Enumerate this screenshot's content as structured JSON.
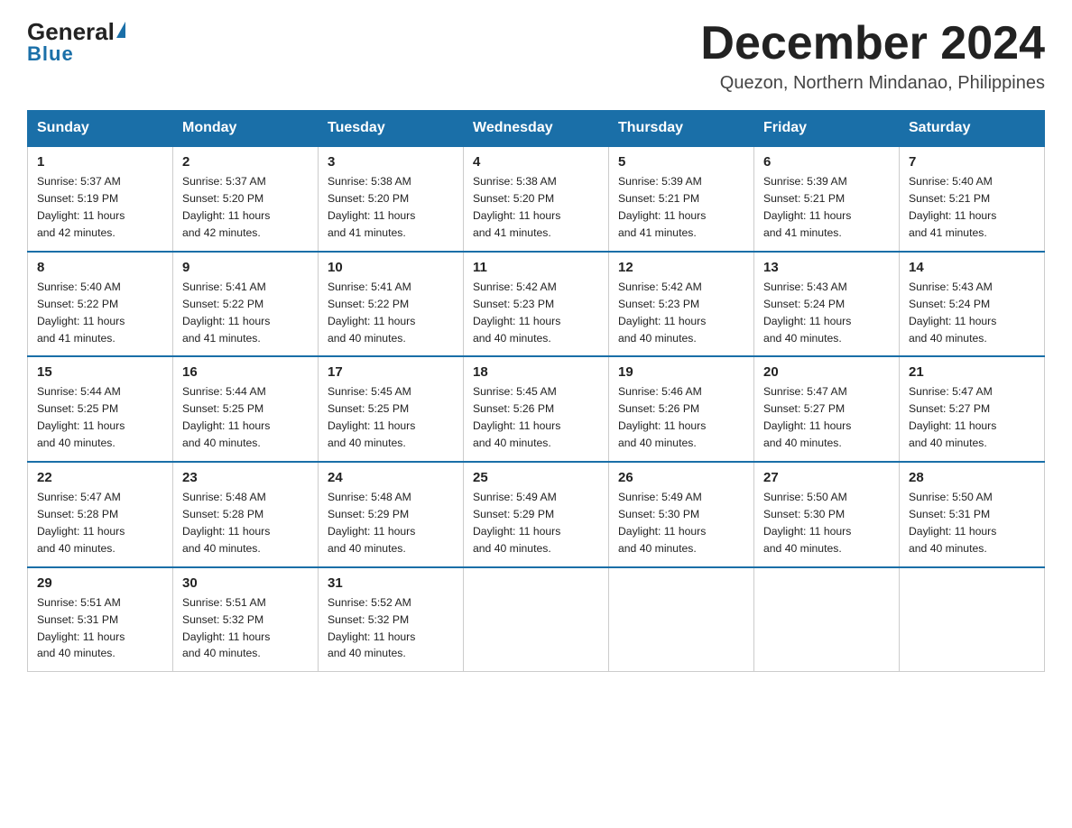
{
  "logo": {
    "general": "General",
    "triangle": "▲",
    "blue": "Blue"
  },
  "title": "December 2024",
  "subtitle": "Quezon, Northern Mindanao, Philippines",
  "days": [
    "Sunday",
    "Monday",
    "Tuesday",
    "Wednesday",
    "Thursday",
    "Friday",
    "Saturday"
  ],
  "weeks": [
    [
      {
        "day": "1",
        "sunrise": "5:37 AM",
        "sunset": "5:19 PM",
        "daylight": "11 hours and 42 minutes."
      },
      {
        "day": "2",
        "sunrise": "5:37 AM",
        "sunset": "5:20 PM",
        "daylight": "11 hours and 42 minutes."
      },
      {
        "day": "3",
        "sunrise": "5:38 AM",
        "sunset": "5:20 PM",
        "daylight": "11 hours and 41 minutes."
      },
      {
        "day": "4",
        "sunrise": "5:38 AM",
        "sunset": "5:20 PM",
        "daylight": "11 hours and 41 minutes."
      },
      {
        "day": "5",
        "sunrise": "5:39 AM",
        "sunset": "5:21 PM",
        "daylight": "11 hours and 41 minutes."
      },
      {
        "day": "6",
        "sunrise": "5:39 AM",
        "sunset": "5:21 PM",
        "daylight": "11 hours and 41 minutes."
      },
      {
        "day": "7",
        "sunrise": "5:40 AM",
        "sunset": "5:21 PM",
        "daylight": "11 hours and 41 minutes."
      }
    ],
    [
      {
        "day": "8",
        "sunrise": "5:40 AM",
        "sunset": "5:22 PM",
        "daylight": "11 hours and 41 minutes."
      },
      {
        "day": "9",
        "sunrise": "5:41 AM",
        "sunset": "5:22 PM",
        "daylight": "11 hours and 41 minutes."
      },
      {
        "day": "10",
        "sunrise": "5:41 AM",
        "sunset": "5:22 PM",
        "daylight": "11 hours and 40 minutes."
      },
      {
        "day": "11",
        "sunrise": "5:42 AM",
        "sunset": "5:23 PM",
        "daylight": "11 hours and 40 minutes."
      },
      {
        "day": "12",
        "sunrise": "5:42 AM",
        "sunset": "5:23 PM",
        "daylight": "11 hours and 40 minutes."
      },
      {
        "day": "13",
        "sunrise": "5:43 AM",
        "sunset": "5:24 PM",
        "daylight": "11 hours and 40 minutes."
      },
      {
        "day": "14",
        "sunrise": "5:43 AM",
        "sunset": "5:24 PM",
        "daylight": "11 hours and 40 minutes."
      }
    ],
    [
      {
        "day": "15",
        "sunrise": "5:44 AM",
        "sunset": "5:25 PM",
        "daylight": "11 hours and 40 minutes."
      },
      {
        "day": "16",
        "sunrise": "5:44 AM",
        "sunset": "5:25 PM",
        "daylight": "11 hours and 40 minutes."
      },
      {
        "day": "17",
        "sunrise": "5:45 AM",
        "sunset": "5:25 PM",
        "daylight": "11 hours and 40 minutes."
      },
      {
        "day": "18",
        "sunrise": "5:45 AM",
        "sunset": "5:26 PM",
        "daylight": "11 hours and 40 minutes."
      },
      {
        "day": "19",
        "sunrise": "5:46 AM",
        "sunset": "5:26 PM",
        "daylight": "11 hours and 40 minutes."
      },
      {
        "day": "20",
        "sunrise": "5:47 AM",
        "sunset": "5:27 PM",
        "daylight": "11 hours and 40 minutes."
      },
      {
        "day": "21",
        "sunrise": "5:47 AM",
        "sunset": "5:27 PM",
        "daylight": "11 hours and 40 minutes."
      }
    ],
    [
      {
        "day": "22",
        "sunrise": "5:47 AM",
        "sunset": "5:28 PM",
        "daylight": "11 hours and 40 minutes."
      },
      {
        "day": "23",
        "sunrise": "5:48 AM",
        "sunset": "5:28 PM",
        "daylight": "11 hours and 40 minutes."
      },
      {
        "day": "24",
        "sunrise": "5:48 AM",
        "sunset": "5:29 PM",
        "daylight": "11 hours and 40 minutes."
      },
      {
        "day": "25",
        "sunrise": "5:49 AM",
        "sunset": "5:29 PM",
        "daylight": "11 hours and 40 minutes."
      },
      {
        "day": "26",
        "sunrise": "5:49 AM",
        "sunset": "5:30 PM",
        "daylight": "11 hours and 40 minutes."
      },
      {
        "day": "27",
        "sunrise": "5:50 AM",
        "sunset": "5:30 PM",
        "daylight": "11 hours and 40 minutes."
      },
      {
        "day": "28",
        "sunrise": "5:50 AM",
        "sunset": "5:31 PM",
        "daylight": "11 hours and 40 minutes."
      }
    ],
    [
      {
        "day": "29",
        "sunrise": "5:51 AM",
        "sunset": "5:31 PM",
        "daylight": "11 hours and 40 minutes."
      },
      {
        "day": "30",
        "sunrise": "5:51 AM",
        "sunset": "5:32 PM",
        "daylight": "11 hours and 40 minutes."
      },
      {
        "day": "31",
        "sunrise": "5:52 AM",
        "sunset": "5:32 PM",
        "daylight": "11 hours and 40 minutes."
      },
      null,
      null,
      null,
      null
    ]
  ],
  "labels": {
    "sunrise": "Sunrise: ",
    "sunset": "Sunset: ",
    "daylight": "Daylight: "
  }
}
